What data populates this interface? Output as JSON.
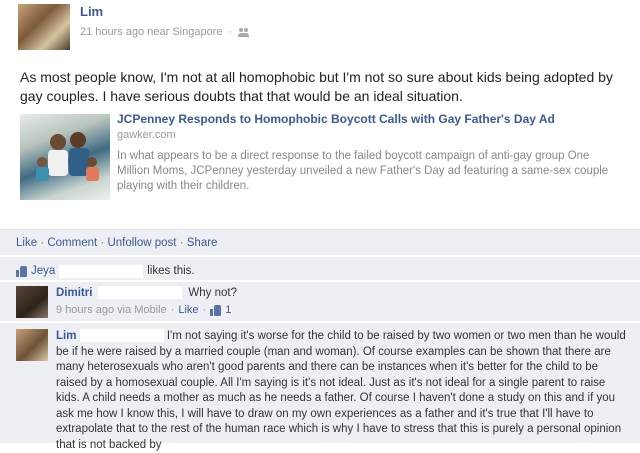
{
  "post": {
    "author": "Lim",
    "time": "21 hours ago near Singapore",
    "dot": "·",
    "status": "As most people know, I'm not at all homophobic but I'm not so sure about kids being adopted by gay couples. I have serious doubts that that would be an ideal situation."
  },
  "link": {
    "title": "JCPenney Responds to Homophobic Boycott Calls with Gay Father's Day Ad",
    "domain": "gawker.com",
    "description": "In what appears to be a direct response to the failed boycott campaign of anti-gay group One Million Moms, JCPenney yesterday unveiled a new Father's Day ad featuring a same-sex couple playing with their children."
  },
  "actions": {
    "like": "Like",
    "comment": "Comment",
    "unfollow": "Unfollow post",
    "share": "Share",
    "sep": "·"
  },
  "likes": {
    "liker": "Jeya",
    "text": "likes this."
  },
  "comments": [
    {
      "author": "Dimitri",
      "text": "Why not?",
      "time": "9 hours ago via Mobile",
      "like": "Like",
      "like_count": "1"
    },
    {
      "author": "Lim",
      "text": "I'm not saying it's worse for the child to be raised by two women or two men than he would be if he were raised by a married couple (man and woman). Of course examples can be shown that there are many heterosexuals who aren't good parents and there can be instances when it's better for the child to be raised by a homosexual couple. All I'm saying is it's not ideal. Just as it's not ideal for a single parent to raise kids. A child needs a mother as much as he needs a father. Of course I haven't done a study on this and if you ask me how I know this, I will have to draw on my own experiences as a father and it's true that I'll have to extrapolate that to the rest of the human race which is why I have to stress that this is purely a personal opinion that is not backed by"
    }
  ],
  "colors": {
    "link_blue": "#3b5998",
    "comment_bg": "#edeff4"
  }
}
